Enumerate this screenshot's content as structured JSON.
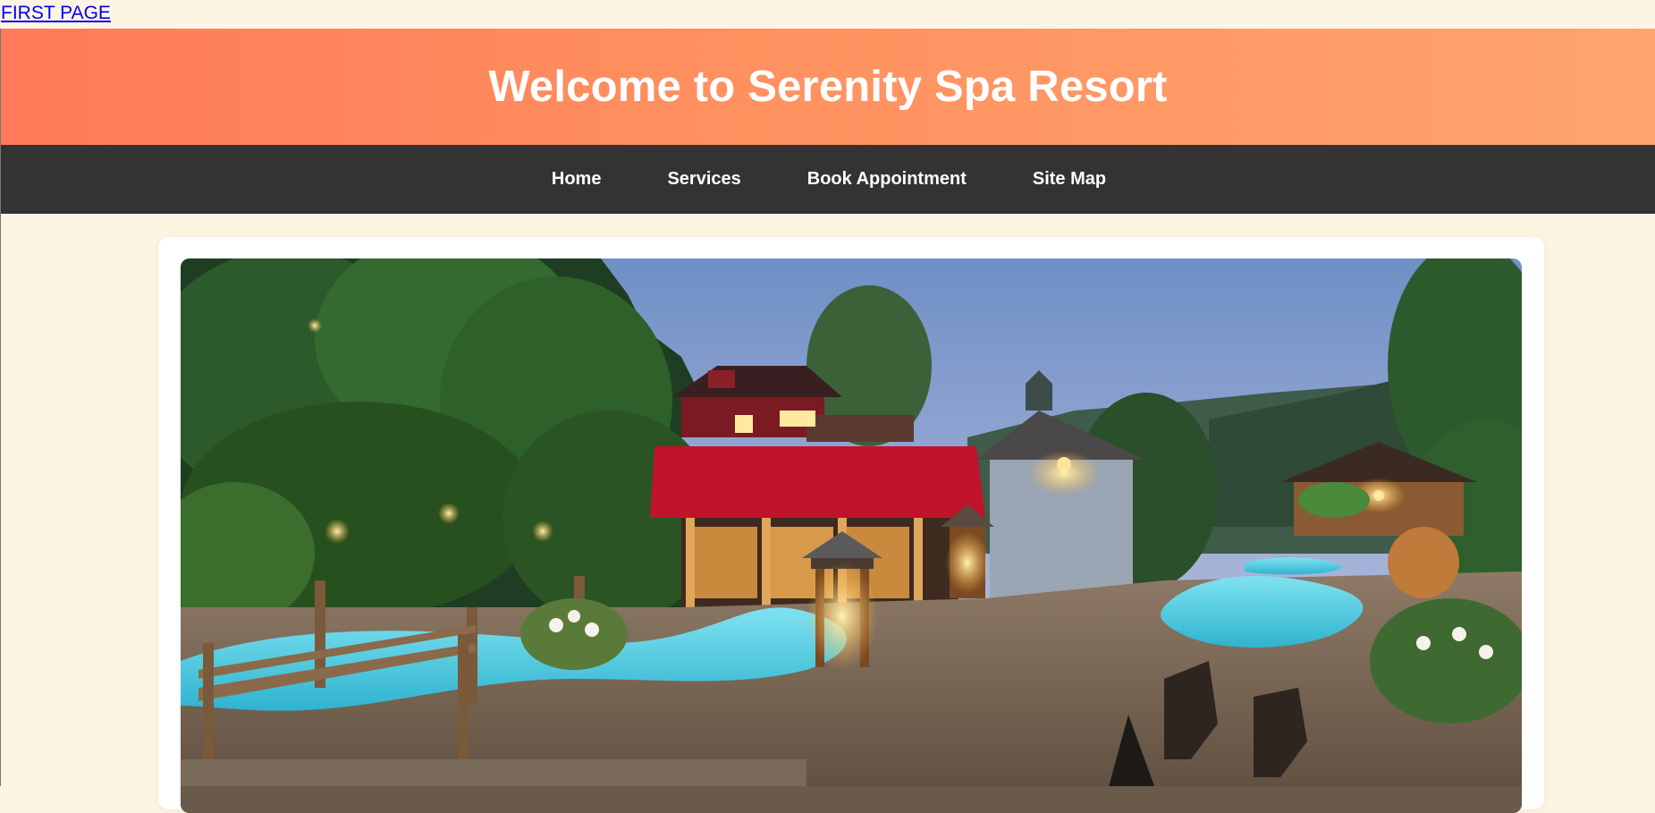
{
  "top_link": {
    "label": "FIRST PAGE"
  },
  "header": {
    "title": "Welcome to Serenity Spa Resort"
  },
  "nav": {
    "items": [
      {
        "label": "Home"
      },
      {
        "label": "Services"
      },
      {
        "label": "Book Appointment"
      },
      {
        "label": "Site Map"
      }
    ]
  },
  "hero": {
    "description_icon": "spa-resort-photo"
  },
  "colors": {
    "page_bg": "#fdf5e3",
    "banner_start": "#ff7a5a",
    "banner_end": "#ffa36e",
    "nav_bg": "#333333",
    "link": "#0000ee"
  }
}
